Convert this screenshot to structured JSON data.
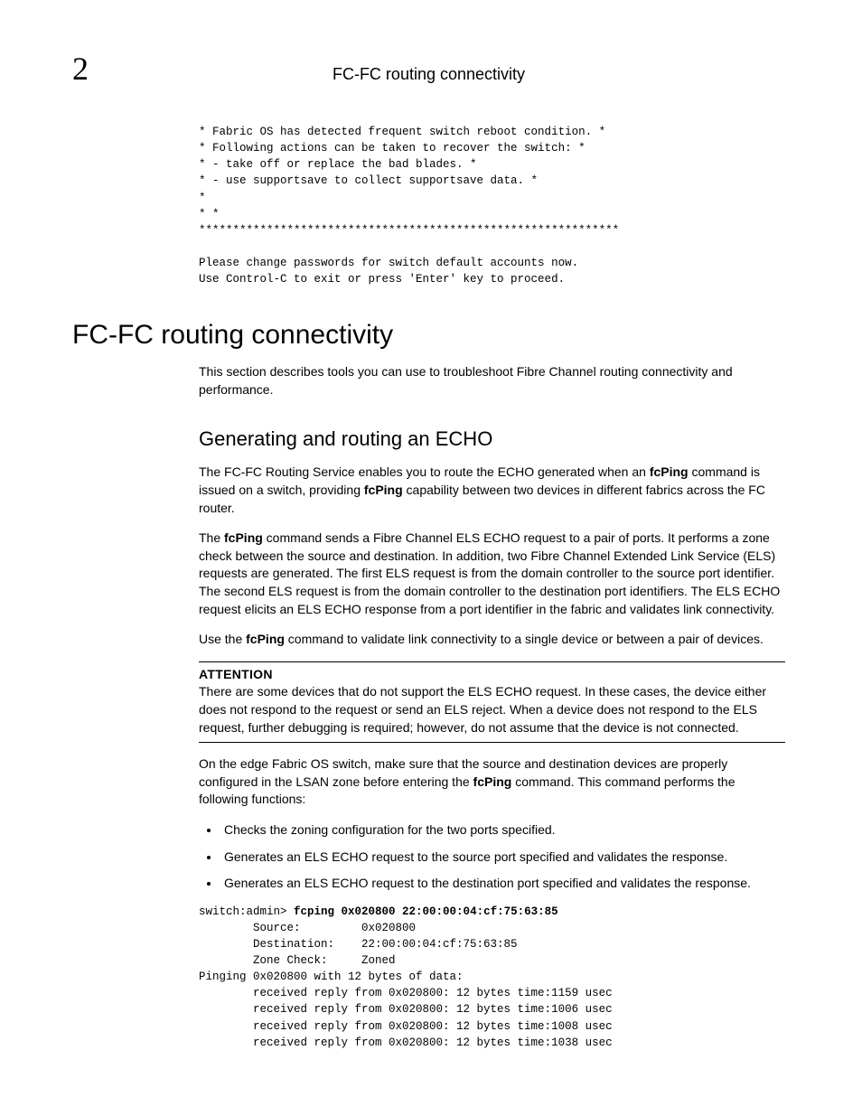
{
  "header": {
    "chapter_number": "2",
    "running_title": "FC-FC routing connectivity"
  },
  "code_block_top": "* Fabric OS has detected frequent switch reboot condition. *\n* Following actions can be taken to recover the switch: *\n* - take off or replace the bad blades. *\n* - use supportsave to collect supportsave data. *\n*\n* *\n**************************************************************\n\nPlease change passwords for switch default accounts now.\nUse Control-C to exit or press 'Enter' key to proceed.",
  "h1": "FC-FC routing connectivity",
  "intro": "This section describes tools you can use to troubleshoot Fibre Channel routing connectivity and performance.",
  "h2": "Generating and routing an ECHO",
  "para1": {
    "t1": "The FC-FC Routing Service enables you to route the ECHO generated when an ",
    "b1": "fcPing",
    "t2": " command is issued on a switch, providing ",
    "b2": "fcPing",
    "t3": " capability between two devices in different fabrics across the FC router."
  },
  "para2": {
    "t1": "The ",
    "b1": "fcPing",
    "t2": " command sends a Fibre Channel ELS ECHO request to a pair of ports. It performs a zone check between the source and destination. In addition, two Fibre Channel Extended Link Service (ELS) requests are generated. The first ELS request is from the domain controller to the source port identifier. The second ELS request is from the domain controller to the destination port identifiers. The ELS ECHO request elicits an ELS ECHO response from a port identifier in the fabric and validates link connectivity."
  },
  "para3": {
    "t1": "Use the ",
    "b1": "fcPing",
    "t2": " command to validate link connectivity to a single device or between a pair of devices."
  },
  "attention": {
    "label": "ATTENTION",
    "body": "There are some devices that do not support the ELS ECHO request. In these cases, the device either does not respond to the request or send an ELS reject. When a device does not respond to the ELS request, further debugging is required; however, do not assume that the device is not connected."
  },
  "para4": {
    "t1": "On the edge Fabric OS switch, make sure that the source and destination devices are properly configured in the LSAN zone before entering the ",
    "b1": "fcPing",
    "t2": " command. This command performs the following functions:"
  },
  "bullets": [
    "Checks the zoning configuration for the two ports specified.",
    "Generates an ELS ECHO request to the source port specified and validates the response.",
    "Generates an ELS ECHO request to the destination port specified and validates the response."
  ],
  "cmd": {
    "prompt": "switch:admin> ",
    "command": "fcping 0x020800 22:00:00:04:cf:75:63:85",
    "output": "        Source:         0x020800\n        Destination:    22:00:00:04:cf:75:63:85\n        Zone Check:     Zoned\nPinging 0x020800 with 12 bytes of data:\n        received reply from 0x020800: 12 bytes time:1159 usec\n        received reply from 0x020800: 12 bytes time:1006 usec\n        received reply from 0x020800: 12 bytes time:1008 usec\n        received reply from 0x020800: 12 bytes time:1038 usec"
  }
}
